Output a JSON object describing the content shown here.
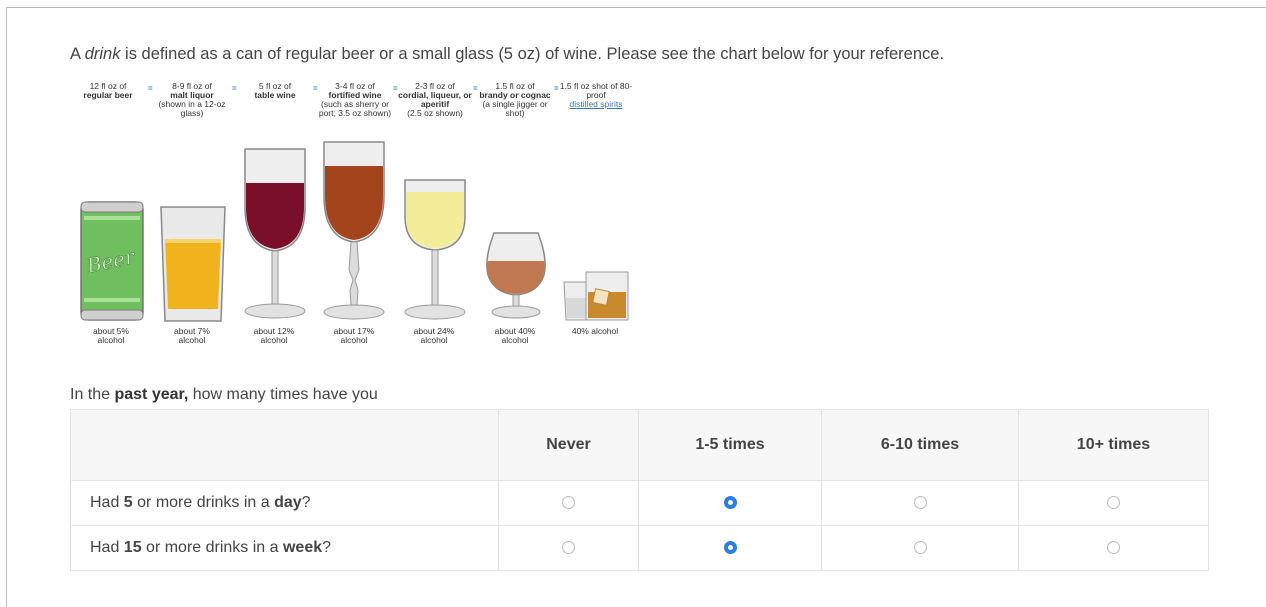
{
  "intro": {
    "before": "A ",
    "emph": "drink",
    "after": " is defined as a can of regular beer or a small glass (5 oz) of wine. Please see the chart below for your reference."
  },
  "drinks": [
    {
      "cap1": "12 fl oz of",
      "cap2": "regular beer",
      "cap3": "",
      "pct": "about 5%",
      "pct2": "alcohol"
    },
    {
      "cap1": "8-9 fl oz of",
      "cap2": "malt liquor",
      "cap3": "(shown in a 12-oz glass)",
      "pct": "about 7%",
      "pct2": "alcohol"
    },
    {
      "cap1": "5 fl oz of",
      "cap2": "table wine",
      "cap3": "",
      "pct": "about 12%",
      "pct2": "alcohol"
    },
    {
      "cap1": "3-4 fl oz of",
      "cap2": "fortified wine",
      "cap3": "(such as sherry or port; 3.5 oz shown)",
      "pct": "about 17%",
      "pct2": "alcohol"
    },
    {
      "cap1": "2-3 fl oz of",
      "cap2": "cordial, liqueur, or aperitif",
      "cap3": "(2.5 oz shown)",
      "pct": "about 24%",
      "pct2": "alcohol"
    },
    {
      "cap1": "1.5 fl oz of",
      "cap2": "brandy or cognac",
      "cap3": "(a single jigger or shot)",
      "pct": "about 40%",
      "pct2": "alcohol"
    },
    {
      "cap1": "1.5 fl oz shot of 80-proof",
      "cap2": "",
      "cap3": "distilled spirits",
      "pct": "40% alcohol",
      "pct2": ""
    }
  ],
  "beer_label": "Beer",
  "question": {
    "before": "In the ",
    "bold": "past year,",
    "after": " how many times have you"
  },
  "columns": [
    "Never",
    "1-5 times",
    "6-10 times",
    "10+ times"
  ],
  "rows": [
    {
      "a": "Had ",
      "b": "5",
      "c": " or more drinks in a ",
      "d": "day",
      "e": "?",
      "selected": 1
    },
    {
      "a": "Had ",
      "b": "15",
      "c": " or more drinks in a ",
      "d": "week",
      "e": "?",
      "selected": 1
    }
  ],
  "colors": {
    "accent": "#2a7fe0",
    "link": "#3a78b6",
    "equals": "#4a7fc4"
  }
}
